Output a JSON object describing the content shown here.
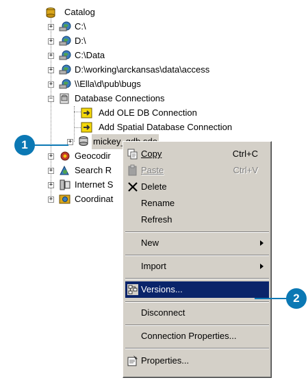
{
  "tree": {
    "root": "Catalog",
    "items": [
      {
        "label": "C:\\"
      },
      {
        "label": "D:\\"
      },
      {
        "label": "C:\\Data"
      },
      {
        "label": "D:\\working\\arckansas\\data\\access"
      },
      {
        "label": "\\\\Ella\\d\\pub\\bugs"
      },
      {
        "label": "Database Connections"
      },
      {
        "label": "Add OLE DB Connection"
      },
      {
        "label": "Add Spatial Database Connection"
      },
      {
        "label": "mickey_gdb.sde"
      },
      {
        "label": "Geocodir"
      },
      {
        "label": "Search R"
      },
      {
        "label": "Internet S"
      },
      {
        "label": "Coordinat"
      }
    ]
  },
  "menu": {
    "copy": {
      "label": "Copy",
      "shortcut": "Ctrl+C"
    },
    "paste": {
      "label": "Paste",
      "shortcut": "Ctrl+V"
    },
    "delete": {
      "label": "Delete"
    },
    "rename": {
      "label": "Rename"
    },
    "refresh": {
      "label": "Refresh"
    },
    "new": {
      "label": "New"
    },
    "import": {
      "label": "Import"
    },
    "versions": {
      "label": "Versions..."
    },
    "disconnect": {
      "label": "Disconnect"
    },
    "connection_properties": {
      "label": "Connection Properties..."
    },
    "properties": {
      "label": "Properties..."
    }
  },
  "callouts": {
    "one": "1",
    "two": "2"
  },
  "colors": {
    "callout": "#0b78b4",
    "highlight": "#0a246a",
    "menu_bg": "#d4d0c8"
  }
}
